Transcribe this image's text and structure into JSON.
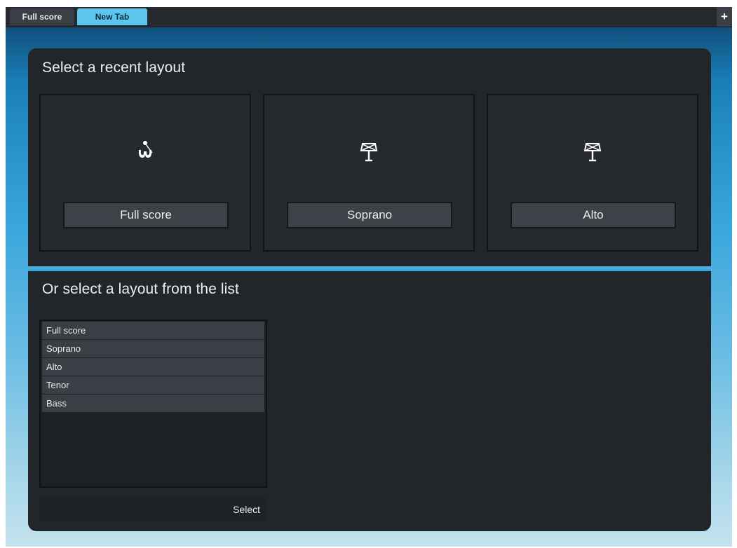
{
  "tabs": [
    {
      "label": "Full score",
      "active": false
    },
    {
      "label": "New Tab",
      "active": true
    }
  ],
  "add_tab_icon": "plus-icon",
  "recent": {
    "title": "Select a recent layout",
    "cards": [
      {
        "label": "Full score",
        "icon": "conductor-icon"
      },
      {
        "label": "Soprano",
        "icon": "music-stand-icon"
      },
      {
        "label": "Alto",
        "icon": "music-stand-icon"
      }
    ]
  },
  "list": {
    "title": "Or select a layout from the list",
    "items": [
      "Full score",
      "Soprano",
      "Alto",
      "Tenor",
      "Bass"
    ],
    "select_label": "Select"
  },
  "colors": {
    "accent": "#5cc6ee",
    "panel": "#22252a",
    "button": "#3d4249"
  }
}
